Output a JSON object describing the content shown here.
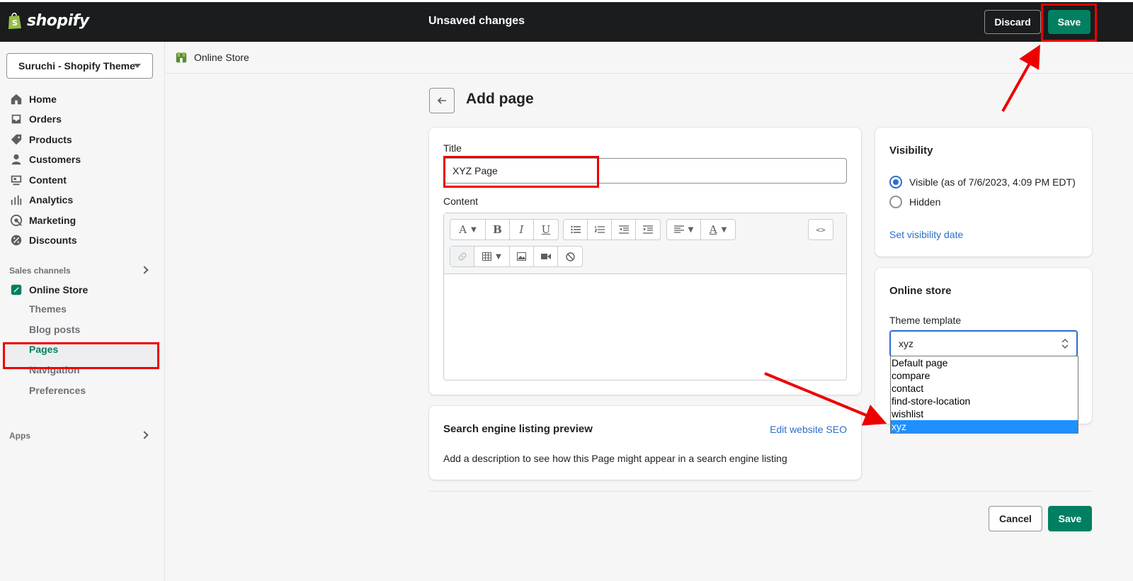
{
  "topbar": {
    "logo_text": "shopify",
    "status": "Unsaved changes",
    "discard_label": "Discard",
    "save_label": "Save"
  },
  "sidebar": {
    "store_name": "Suruchi - Shopify Theme",
    "items": [
      {
        "label": "Home",
        "icon": "home-icon"
      },
      {
        "label": "Orders",
        "icon": "orders-icon"
      },
      {
        "label": "Products",
        "icon": "tag-icon"
      },
      {
        "label": "Customers",
        "icon": "person-icon"
      },
      {
        "label": "Content",
        "icon": "content-icon"
      },
      {
        "label": "Analytics",
        "icon": "bar-chart-icon"
      },
      {
        "label": "Marketing",
        "icon": "target-icon"
      },
      {
        "label": "Discounts",
        "icon": "discount-icon"
      }
    ],
    "sales_channels_label": "Sales channels",
    "online_store_label": "Online Store",
    "sub_items": [
      "Themes",
      "Blog posts",
      "Pages",
      "Navigation",
      "Preferences"
    ],
    "active_sub_item": "Pages",
    "apps_label": "Apps"
  },
  "breadcrumb": {
    "label": "Online Store"
  },
  "page": {
    "title": "Add page",
    "title_field_label": "Title",
    "title_field_value": "XYZ Page",
    "content_label": "Content"
  },
  "seo": {
    "title": "Search engine listing preview",
    "edit_link": "Edit website SEO",
    "description": "Add a description to see how this Page might appear in a search engine listing"
  },
  "visibility": {
    "title": "Visibility",
    "visible_label": "Visible (as of 7/6/2023, 4:09 PM EDT)",
    "hidden_label": "Hidden",
    "selected": "visible",
    "set_date_link": "Set visibility date"
  },
  "online_store": {
    "title": "Online store",
    "template_label": "Theme template",
    "template_value": "xyz",
    "options": [
      "Default page",
      "compare",
      "contact",
      "find-store-location",
      "wishlist",
      "xyz"
    ],
    "highlighted_option": "xyz"
  },
  "footer": {
    "cancel_label": "Cancel",
    "save_label": "Save"
  },
  "colors": {
    "primary": "#008060",
    "link": "#2c6ecb",
    "annotation": "#ee0000",
    "topbar": "#1a1c1d"
  }
}
